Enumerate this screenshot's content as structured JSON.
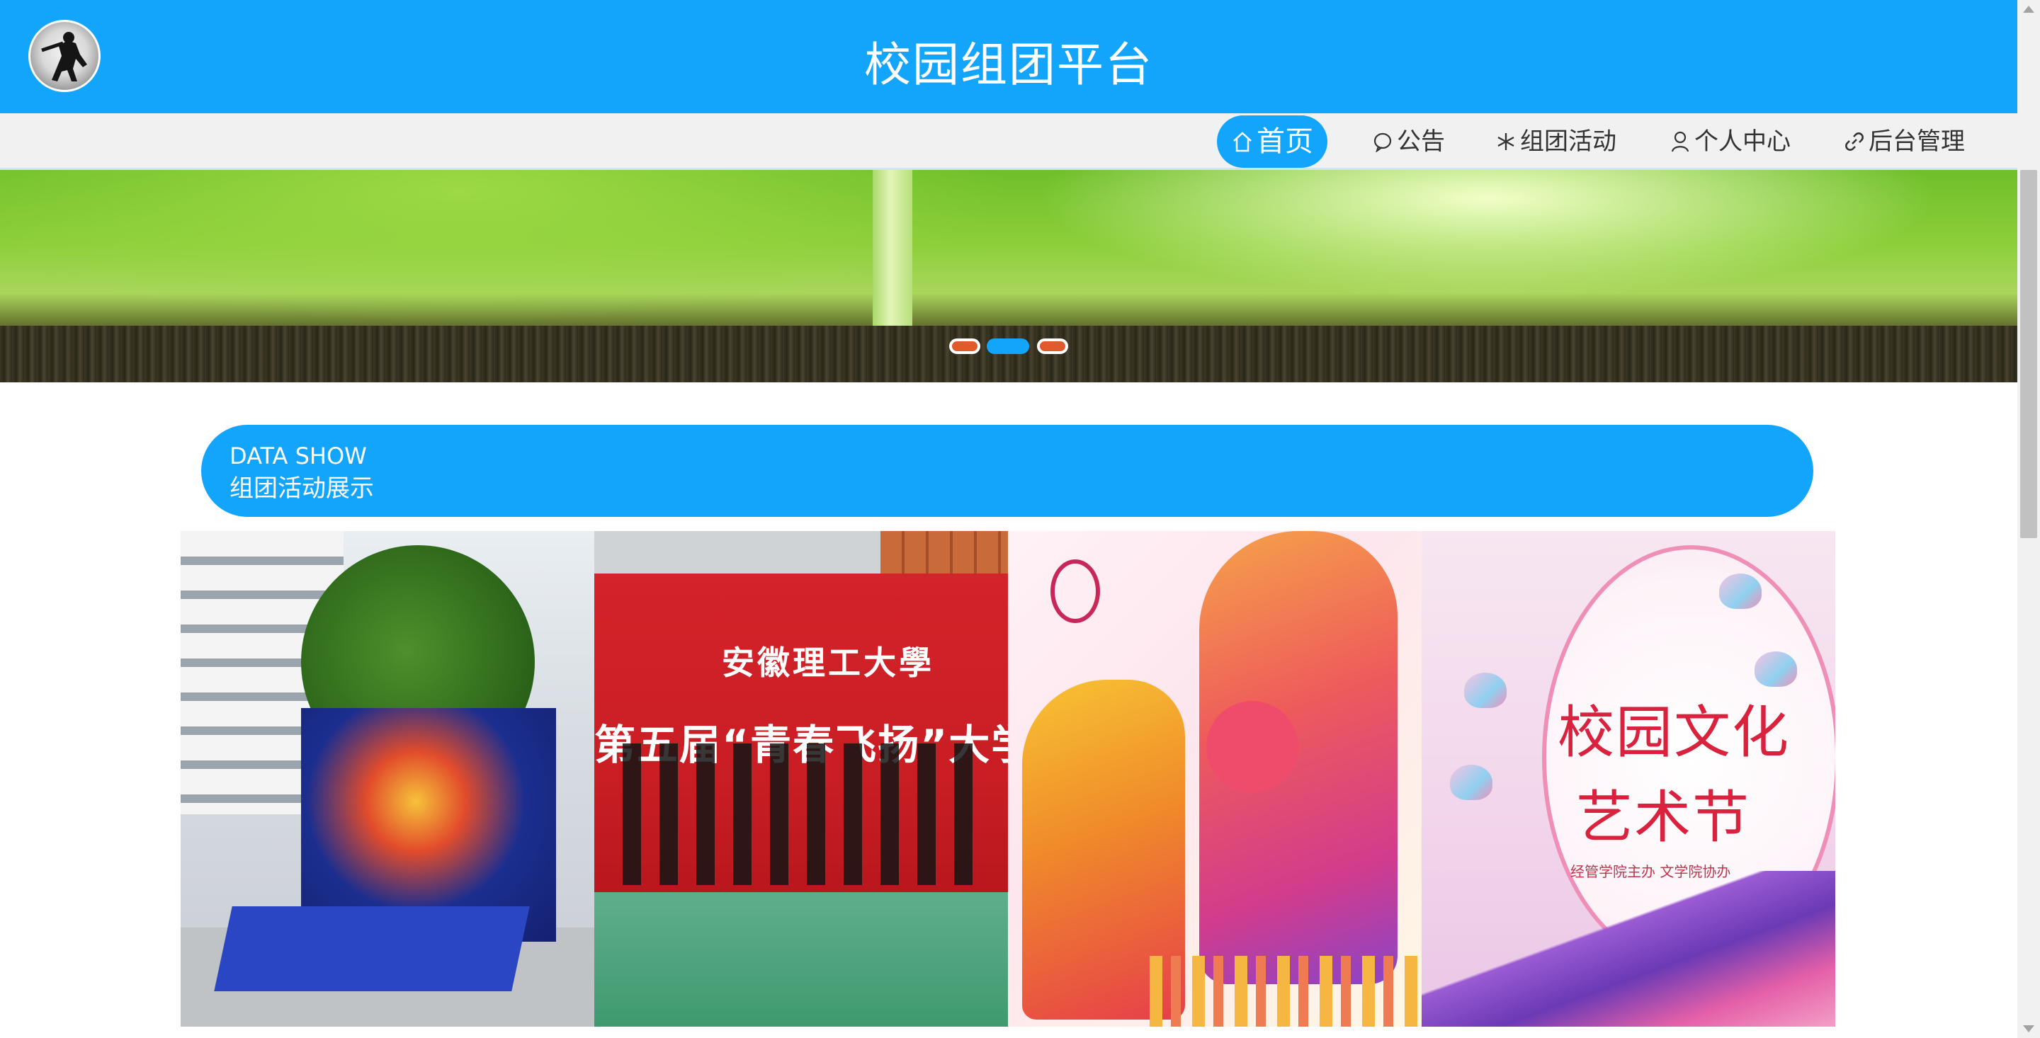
{
  "header": {
    "title": "校园组团平台",
    "logo_icon": "shadow-silhouette-logo"
  },
  "nav": {
    "items": [
      {
        "label": "首页",
        "icon": "home-icon",
        "active": true
      },
      {
        "label": "公告",
        "icon": "chat-bubble-icon",
        "active": false
      },
      {
        "label": "组团活动",
        "icon": "snowflake-icon",
        "active": false
      },
      {
        "label": "个人中心",
        "icon": "user-icon",
        "active": false
      },
      {
        "label": "后台管理",
        "icon": "link-icon",
        "active": false
      }
    ]
  },
  "carousel": {
    "slide_count": 3,
    "active_index": 1
  },
  "section": {
    "label_en": "DATA SHOW",
    "label_cn": "组团活动展示"
  },
  "gallery": {
    "tiles": [
      {
        "name": "campus-promo-stand-photo"
      },
      {
        "name": "dance-competition-photo",
        "university": "安徽理工大學",
        "slogan": "第五届“青春飞扬”大学生舞蹈大"
      },
      {
        "name": "sports-silhouette-poster"
      },
      {
        "name": "culture-art-festival-poster",
        "title_line1": "校园文化",
        "title_line2": "艺术节",
        "subtitle": "经管学院主办 文学院协办"
      }
    ]
  },
  "colors": {
    "primary": "#12a5fb",
    "nav_bg": "#f1f1f1",
    "text": "#333333"
  }
}
